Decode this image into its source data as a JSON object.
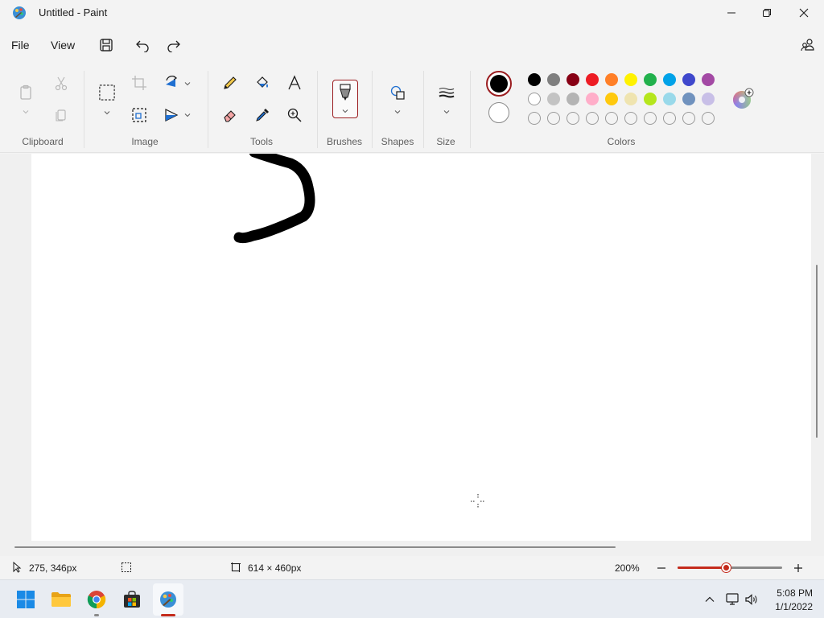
{
  "window": {
    "title": "Untitled - Paint"
  },
  "menu": {
    "file": "File",
    "view": "View"
  },
  "ribbon": {
    "groups": {
      "clipboard": "Clipboard",
      "image": "Image",
      "tools": "Tools",
      "brushes": "Brushes",
      "shapes": "Shapes",
      "size": "Size",
      "colors": "Colors"
    },
    "primary_color": "#000000",
    "secondary_color": "#ffffff",
    "palette_row1": [
      "#000000",
      "#7f7f7f",
      "#880015",
      "#ed1c24",
      "#ff7f27",
      "#fff200",
      "#22b14c",
      "#00a2e8",
      "#3f48cc",
      "#a349a4"
    ],
    "palette_row2": [
      "#ffffff",
      "#c3c3c3",
      "#b4b4b4",
      "#ffaec9",
      "#ffc90e",
      "#efe4b0",
      "#b5e61d",
      "#99d9ea",
      "#7092be",
      "#c8bfe7"
    ]
  },
  "status": {
    "cursor_position": "275, 346px",
    "canvas_size": "614 × 460px",
    "zoom": "200%",
    "zoom_fraction": 0.46
  },
  "taskbar": {
    "time": "5:08 PM",
    "date": "1/1/2022"
  }
}
